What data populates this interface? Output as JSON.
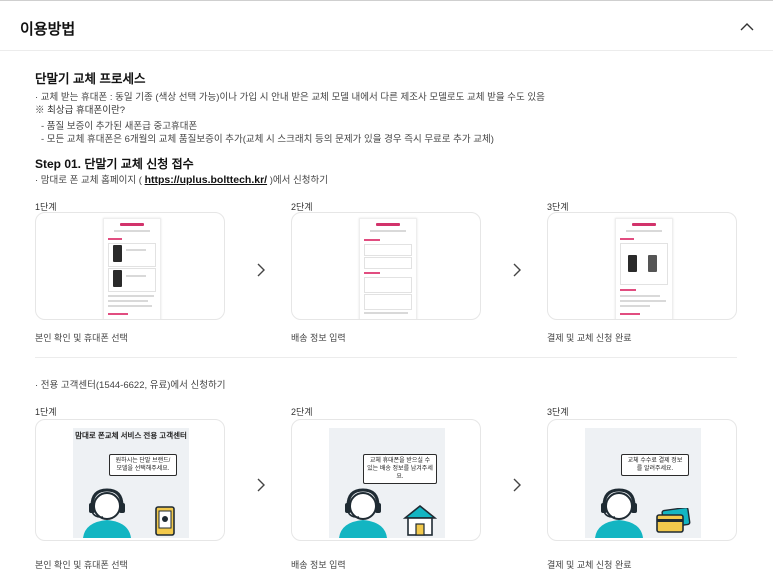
{
  "header": {
    "title": "이용방법"
  },
  "intro": {
    "title": "단말기 교체 프로세스",
    "line1": "· 교체 받는 휴대폰 : 동일 기종 (색상 선택 가능)이나 가입 시 안내 받은 교체 모델 내에서 다른 제조사 모델로도 교체 받을 수도 있음",
    "note": "※ 최상급 휴대폰이란?",
    "sub1": "- 품질 보증이 추가된 새폰급 중고휴대폰",
    "sub2": "- 모든 교체 휴대폰은 6개월의 교체 품질보증이 추가(교체 시 스크래치 등의 문제가 있을 경우 즉시 무료로 추가 교체)"
  },
  "step1": {
    "title": "Step 01. 단말기 교체 신청 접수",
    "line_prefix": "· 맘대로 폰 교체 홈페이지 ( ",
    "url": "https://uplus.bolttech.kr/",
    "line_suffix": " )에서 신청하기"
  },
  "web_flow": [
    {
      "stage": "1단계",
      "caption": "본인 확인 및 휴대폰 선택"
    },
    {
      "stage": "2단계",
      "caption": "배송 정보 입력"
    },
    {
      "stage": "3단계",
      "caption": "결제 및 교체 신청 완료"
    }
  ],
  "center": {
    "line": "· 전용 고객센터(1544-6622, 유료)에서 신청하기"
  },
  "call_flow": [
    {
      "stage": "1단계",
      "caption": "본인 확인 및 휴대폰 선택",
      "panel_title": "맘대로 폰교체 서비스 전용 고객센터",
      "bubble": "원하시는 단말 브랜드/모델을 선택해주세요."
    },
    {
      "stage": "2단계",
      "caption": "배송 정보 입력",
      "bubble": "교체 휴대폰을 받으실 수 있는 배송 정보를 남겨주세요."
    },
    {
      "stage": "3단계",
      "caption": "결제 및 교체 신청 완료",
      "bubble": "교체 수수료 결제 정보를 알려주세요."
    }
  ],
  "colors": {
    "brand": "#d2336b",
    "headset": "#1f7f91",
    "person_teal": "#13b5c2"
  }
}
